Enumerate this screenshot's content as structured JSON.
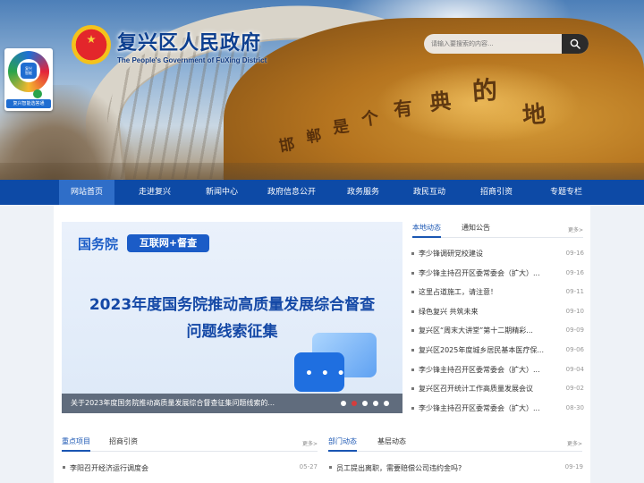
{
  "header": {
    "title": "复兴区人民政府",
    "subtitle": "The People's Government of FuXing District",
    "search_placeholder": "请输入要搜索的内容...",
    "banner_calligraphy": [
      "邯",
      "郸",
      "是",
      "个",
      "有",
      "典",
      "的",
      "地"
    ],
    "qr_logo_line1": "复兴",
    "qr_logo_line2": "智能",
    "qr_label": "复兴智能选答通"
  },
  "nav": {
    "items": [
      {
        "label": "网站首页",
        "active": true
      },
      {
        "label": "走进复兴"
      },
      {
        "label": "新闻中心"
      },
      {
        "label": "政府信息公开"
      },
      {
        "label": "政务服务"
      },
      {
        "label": "政民互动"
      },
      {
        "label": "招商引资"
      },
      {
        "label": "专题专栏"
      }
    ]
  },
  "slider": {
    "tag1": "国务院",
    "tag2": "互联网+督查",
    "headline1": "2023年度国务院推动高质量发展综合督查",
    "headline2": "问题线索征集",
    "caption": "关于2023年度国务院推动高质量发展综合督查征集问题线索的...",
    "dot_count": 5,
    "active_dot": 2
  },
  "news": {
    "tab_local": "本地动态",
    "tab_notice": "通知公告",
    "more": "更多>",
    "items": [
      {
        "title": "李少锋调研党校建设",
        "date": "09-16"
      },
      {
        "title": "李少锋主持召开区委常委会（扩大）...",
        "date": "09-16"
      },
      {
        "title": "这里占道施工，请注意！",
        "date": "09-11"
      },
      {
        "title": "绿色复兴 共筑未来",
        "date": "09-10"
      },
      {
        "title": "复兴区“周末大讲堂”第十二期精彩...",
        "date": "09-09"
      },
      {
        "title": "复兴区2025年度城乡居民基本医疗保...",
        "date": "09-06"
      },
      {
        "title": "李少锋主持召开区委常委会（扩大）...",
        "date": "09-04"
      },
      {
        "title": "复兴区召开统计工作高质量发展会议",
        "date": "09-02"
      },
      {
        "title": "李少锋主持召开区委常委会（扩大）...",
        "date": "08-30"
      }
    ]
  },
  "section_left": {
    "tab1": "重点项目",
    "tab2": "招商引资",
    "more": "更多>",
    "item": {
      "title": "李阳召开经济运行调度会",
      "date": "05-27"
    }
  },
  "section_right": {
    "tab1": "部门动态",
    "tab2": "基层动态",
    "more": "更多>",
    "item": {
      "title": "员工提出离职，需要赔偿公司违约金吗?",
      "date": "09-19"
    }
  },
  "colors": {
    "nav_bg": "#0d4aa6",
    "nav_active": "#2f6ec8",
    "title_blue": "#0d3f8f",
    "accent_blue": "#1a56b3",
    "slider_dot_active": "#d43d3d"
  }
}
